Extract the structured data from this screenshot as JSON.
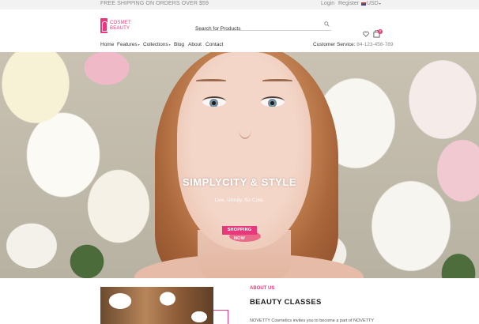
{
  "topbar": {
    "promo": "FREE SHIPPING ON ORDERS OVER $59",
    "login": "Login",
    "register": "Register",
    "currency": "USD"
  },
  "header": {
    "logo_line1": "COSMET",
    "logo_line2": "BEAUTY",
    "search_placeholder": "Search for Products",
    "cart_count": "0"
  },
  "nav": {
    "items": [
      {
        "label": "Home"
      },
      {
        "label": "Features"
      },
      {
        "label": "Collections"
      },
      {
        "label": "Blog"
      },
      {
        "label": "About"
      },
      {
        "label": "Contact"
      }
    ],
    "customer_service_label": "Customer Service:",
    "customer_service_phone": "84-123-456-789"
  },
  "hero": {
    "title": "SIMPLYCITY & STYLE",
    "subtitle": "Live. Unruly. So Cute.",
    "button": "SHOPPING NOW",
    "active_slide": 1,
    "slide_count": 2
  },
  "about": {
    "label": "ABOUT US",
    "title": "BEAUTY CLASSES",
    "text": "NOVETTY Cosmetics invites you to become a part of NOVETTY"
  },
  "colors": {
    "accent": "#e8377a",
    "topbar_bg": "#f2f2f2"
  }
}
